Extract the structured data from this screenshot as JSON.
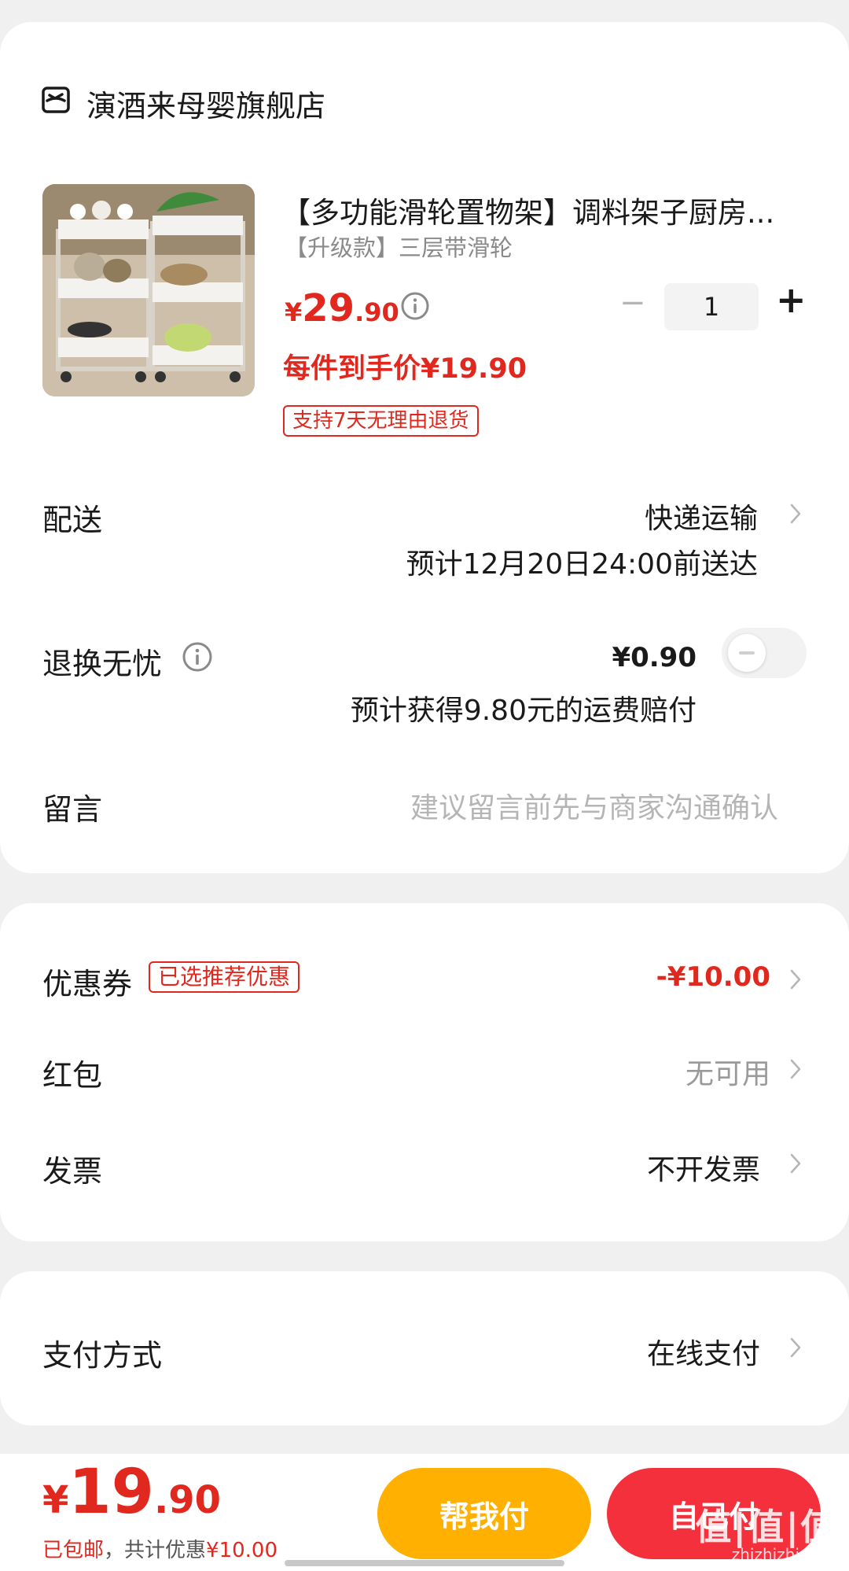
{
  "store": {
    "name": "演酒来母婴旗舰店",
    "icon": "store-icon"
  },
  "product": {
    "title": "【多功能滑轮置物架】调料架子厨房...",
    "spec": "【升级款】三层带滑轮",
    "price_symbol": "¥",
    "price_int": "29",
    "price_dec": ".90",
    "final_price_text": "每件到手价¥19.90",
    "return_tag": "支持7天无理由退货",
    "quantity": "1",
    "minus": "−",
    "plus": "+"
  },
  "delivery": {
    "label": "配送",
    "method": "快递运输",
    "eta": "预计12月20日24:00前送达"
  },
  "return_insurance": {
    "label": "退换无忧",
    "price": "¥0.90",
    "desc": "预计获得9.80元的运费赔付",
    "toggle_on": false
  },
  "message": {
    "label": "留言",
    "placeholder": "建议留言前先与商家沟通确认"
  },
  "discounts": {
    "coupon_label": "优惠券",
    "coupon_tag": "已选推荐优惠",
    "coupon_value": "-¥10.00",
    "redpacket_label": "红包",
    "redpacket_value": "无可用",
    "invoice_label": "发票",
    "invoice_value": "不开发票"
  },
  "payment": {
    "label": "支付方式",
    "value": "在线支付"
  },
  "footer": {
    "total_symbol": "¥",
    "total_int": "19",
    "total_dec": ".90",
    "summary_prefix": "已包邮",
    "summary_rest": "，共计优惠",
    "summary_amount": "¥10.00",
    "help_pay": "帮我付",
    "self_pay": "自己付",
    "watermark": "值|值|值",
    "watermark_sub": "zhizhizhi.com"
  },
  "colors": {
    "accent_red": "#e0281e",
    "help_pay_orange": "#ffb000",
    "self_pay_red": "#f5303d"
  }
}
